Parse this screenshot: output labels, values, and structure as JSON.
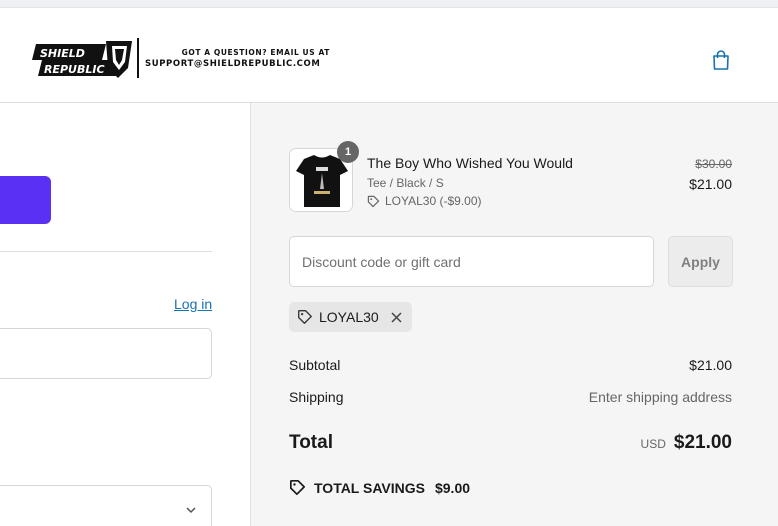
{
  "header": {
    "logo_alt": "Shield Republic",
    "contact_question": "GOT A QUESTION? EMAIL US AT",
    "contact_email": "SUPPORT@SHIELDREPUBLIC.COM",
    "cart_icon": "shopping-bag-icon"
  },
  "left_panel": {
    "express_pay_color": "#5a31f4",
    "login_label": "Log in",
    "select_icon": "chevron-down-icon"
  },
  "order": {
    "item": {
      "quantity": "1",
      "name": "The Boy Who Wished You Would",
      "variant": "Tee / Black / S",
      "discount": "LOYAL30 (-$9.00)",
      "price_original": "$30.00",
      "price": "$21.00"
    },
    "discount_placeholder": "Discount code or gift card",
    "apply_label": "Apply",
    "applied_code": "LOYAL30",
    "subtotal_label": "Subtotal",
    "subtotal_value": "$21.00",
    "shipping_label": "Shipping",
    "shipping_value": "Enter shipping address",
    "total_label": "Total",
    "currency": "USD",
    "total_value": "$21.00",
    "savings_label": "TOTAL SAVINGS",
    "savings_value": "$9.00"
  },
  "colors": {
    "accent": "#5a31f4",
    "link": "#1773b0",
    "summary_bg": "#f5f5f5"
  }
}
